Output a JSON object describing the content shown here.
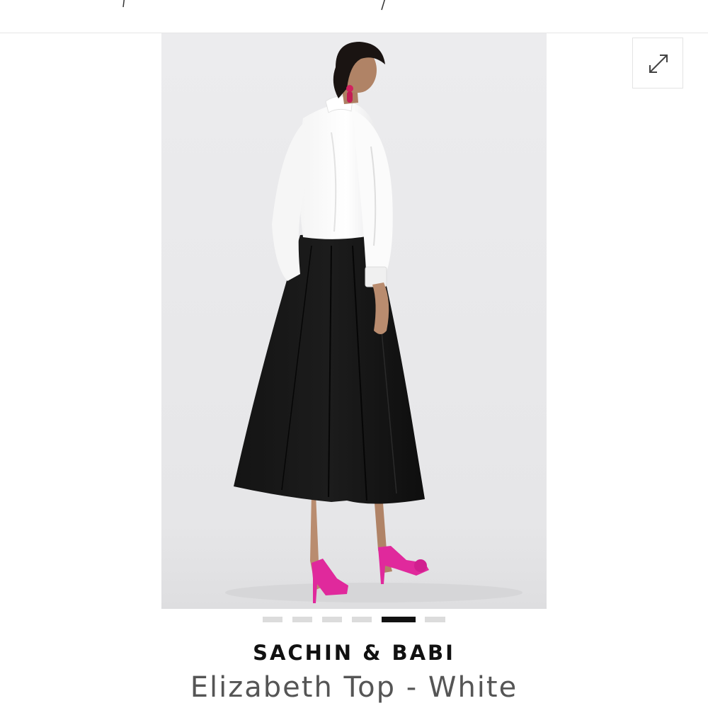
{
  "product": {
    "brand": "SACHIN & BABI",
    "name": "Elizabeth Top - White"
  },
  "gallery": {
    "image_count": 6,
    "active_index": 4,
    "image_description_icon": "model-back-view-photo"
  },
  "controls": {
    "expand_icon": "expand-arrows-icon"
  },
  "colors": {
    "active_dot": "#111111",
    "inactive_dot": "#dcdcdc",
    "brand_text": "#111111",
    "name_text": "#555555"
  }
}
